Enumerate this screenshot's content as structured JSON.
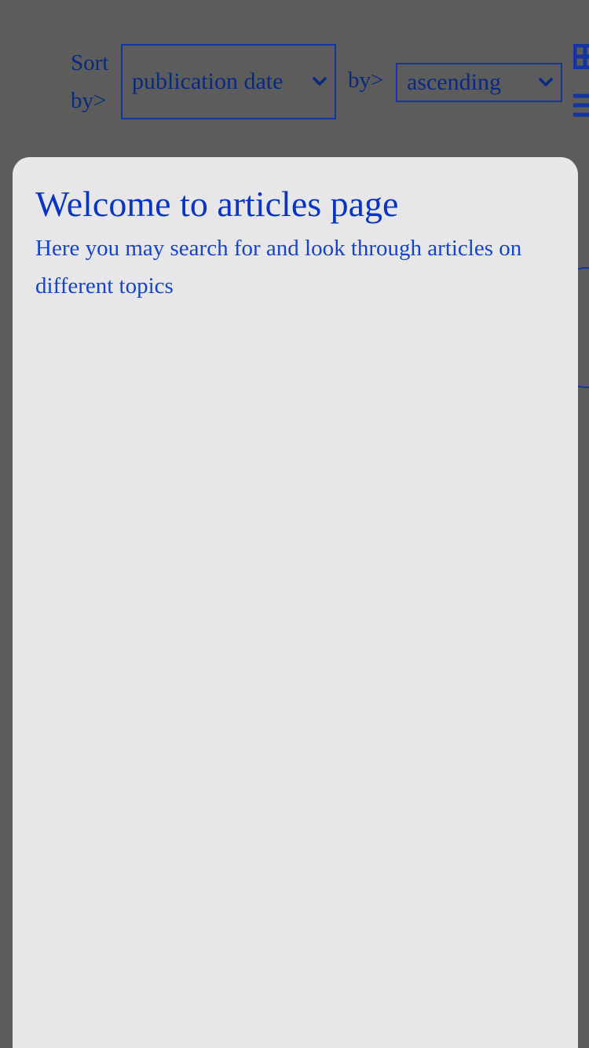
{
  "sort_bar": {
    "sort_label": "Sort by>",
    "sort_field": {
      "selected": "publication date"
    },
    "order_label": "by>",
    "sort_order": {
      "selected": "ascending"
    }
  },
  "view_toggle": {
    "grid_icon": "grid-view-icon",
    "list_icon": "list-view-icon"
  },
  "modal": {
    "title": "Welcome to articles page",
    "text": "Here you may search for and look through articles on different topics"
  },
  "colors": {
    "accent": "#0a35c2",
    "border": "#1535a0",
    "overlay": "#5c5c5c",
    "modal_background": "#e7e7e9"
  }
}
